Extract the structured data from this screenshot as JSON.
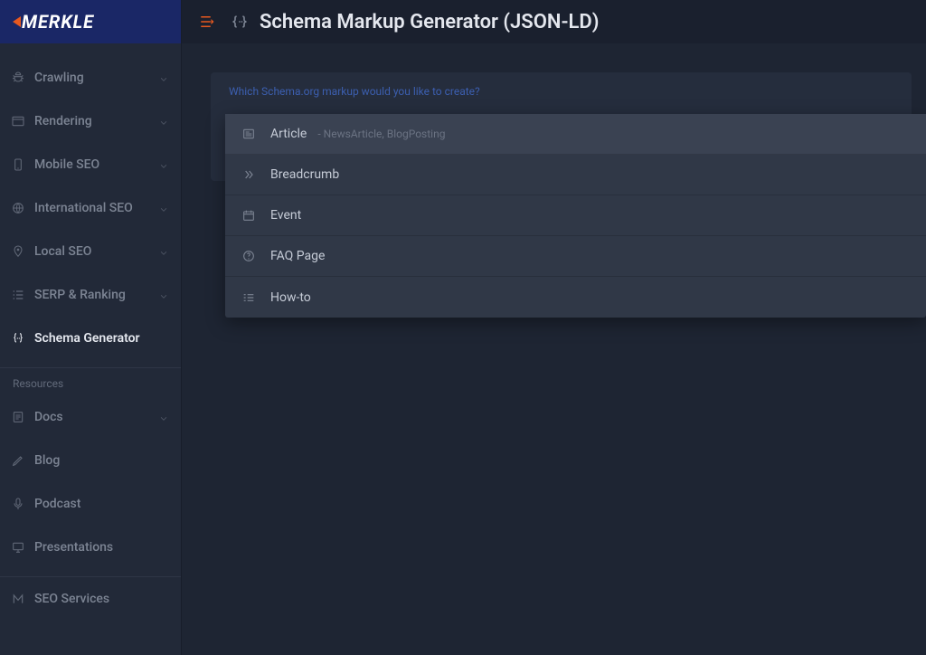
{
  "brand": {
    "name": "MERKLE"
  },
  "header": {
    "title": "Schema Markup Generator (JSON-LD)"
  },
  "sidebar": {
    "items": [
      {
        "id": "crawling",
        "label": "Crawling",
        "icon": "bug-icon",
        "expandable": true
      },
      {
        "id": "rendering",
        "label": "Rendering",
        "icon": "window-icon",
        "expandable": true
      },
      {
        "id": "mobile-seo",
        "label": "Mobile SEO",
        "icon": "phone-icon",
        "expandable": true
      },
      {
        "id": "intl-seo",
        "label": "International SEO",
        "icon": "globe-icon",
        "expandable": true
      },
      {
        "id": "local-seo",
        "label": "Local SEO",
        "icon": "pin-icon",
        "expandable": true
      },
      {
        "id": "serp",
        "label": "SERP & Ranking",
        "icon": "list-icon",
        "expandable": true
      },
      {
        "id": "schema-gen",
        "label": "Schema Generator",
        "icon": "braces-icon",
        "expandable": false,
        "active": true
      }
    ],
    "resources_header": "Resources",
    "resources": [
      {
        "id": "docs",
        "label": "Docs",
        "icon": "doc-icon",
        "expandable": true
      },
      {
        "id": "blog",
        "label": "Blog",
        "icon": "pen-icon",
        "expandable": false
      },
      {
        "id": "podcast",
        "label": "Podcast",
        "icon": "mic-icon",
        "expandable": false
      },
      {
        "id": "presentations",
        "label": "Presentations",
        "icon": "screen-icon",
        "expandable": false
      },
      {
        "id": "seo-services",
        "label": "SEO Services",
        "icon": "m-icon",
        "expandable": false,
        "separated": true
      }
    ]
  },
  "hint_text": "Which Schema.org markup would you like to create?",
  "dropdown": {
    "options": [
      {
        "label": "Article",
        "sub": "- NewsArticle, BlogPosting",
        "icon": "article-icon",
        "selected": true
      },
      {
        "label": "Breadcrumb",
        "sub": "",
        "icon": "chevrons-icon",
        "selected": false
      },
      {
        "label": "Event",
        "sub": "",
        "icon": "calendar-icon",
        "selected": false
      },
      {
        "label": "FAQ Page",
        "sub": "",
        "icon": "help-icon",
        "selected": false
      },
      {
        "label": "How-to",
        "sub": "",
        "icon": "steps-icon",
        "selected": false
      }
    ]
  }
}
